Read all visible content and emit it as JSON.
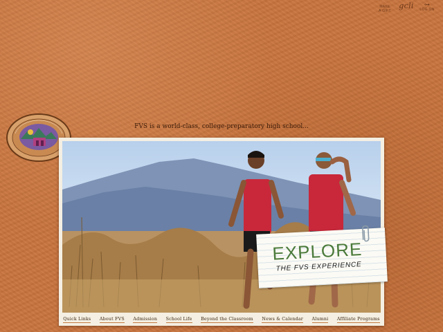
{
  "utility": {
    "gift_label_1": "MAKE",
    "gift_label_2": "A GIFT",
    "gcli_label": "gcli",
    "logon_label": "LOG ON"
  },
  "tagline": "FVS is a world-class, college-preparatory high school...",
  "explore": {
    "title": "EXPLORE",
    "subtitle": "THE FVS EXPERIENCE"
  },
  "nav": [
    {
      "label": "Quick Links"
    },
    {
      "label": "About FVS"
    },
    {
      "label": "Admission"
    },
    {
      "label": "School Life"
    },
    {
      "label": "Beyond the Classroom"
    },
    {
      "label": "News & Calendar"
    },
    {
      "label": "Alumni"
    },
    {
      "label": "Affiliate Programs"
    }
  ],
  "colors": {
    "background": "#c9753e",
    "nav_underline": "#c27a3e",
    "explore_green": "#4a7a3a",
    "jersey_red": "#c8283a"
  }
}
